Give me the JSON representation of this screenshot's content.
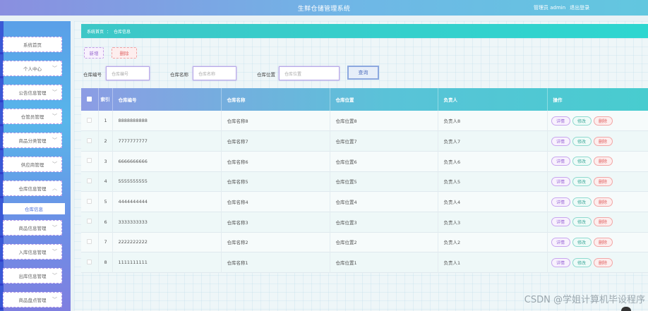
{
  "header": {
    "title": "生鲜仓储管理系统",
    "user": "管理员 admin",
    "logout": "退出登录"
  },
  "sidebar": {
    "items": [
      {
        "label": "系统首页",
        "has_chevron": false
      },
      {
        "label": "个人中心",
        "has_chevron": true
      },
      {
        "label": "公告信息管理",
        "has_chevron": true
      },
      {
        "label": "仓管员管理",
        "has_chevron": true
      },
      {
        "label": "商品分类管理",
        "has_chevron": true
      },
      {
        "label": "供应商管理",
        "has_chevron": true
      },
      {
        "label": "仓库信息管理",
        "has_chevron": true,
        "expanded": true
      },
      {
        "label": "商品信息管理",
        "has_chevron": true
      },
      {
        "label": "入库信息管理",
        "has_chevron": true
      },
      {
        "label": "出库信息管理",
        "has_chevron": true
      },
      {
        "label": "商品盘点管理",
        "has_chevron": true
      }
    ],
    "sub_item": "仓库信息"
  },
  "breadcrumb": {
    "home": "系统首页",
    "sep": "：",
    "current": "仓库信息"
  },
  "toolbar": {
    "add_label": "新增",
    "delete_label": "删除"
  },
  "search": {
    "code_label": "仓库编号",
    "code_placeholder": "仓库编号",
    "name_label": "仓库名称",
    "name_placeholder": "仓库名称",
    "location_label": "仓库位置",
    "location_placeholder": "仓库位置",
    "button": "查询"
  },
  "table": {
    "headers": {
      "index": "索引",
      "code": "仓库编号",
      "name": "仓库名称",
      "location": "仓库位置",
      "manager": "负责人",
      "actions": "操作"
    },
    "rows": [
      {
        "index": "1",
        "code": "8888888888",
        "name": "仓库名称8",
        "location": "仓库位置8",
        "manager": "负责人8"
      },
      {
        "index": "2",
        "code": "7777777777",
        "name": "仓库名称7",
        "location": "仓库位置7",
        "manager": "负责人7"
      },
      {
        "index": "3",
        "code": "6666666666",
        "name": "仓库名称6",
        "location": "仓库位置6",
        "manager": "负责人6"
      },
      {
        "index": "4",
        "code": "5555555555",
        "name": "仓库名称5",
        "location": "仓库位置5",
        "manager": "负责人5"
      },
      {
        "index": "5",
        "code": "4444444444",
        "name": "仓库名称4",
        "location": "仓库位置4",
        "manager": "负责人4"
      },
      {
        "index": "6",
        "code": "3333333333",
        "name": "仓库名称3",
        "location": "仓库位置3",
        "manager": "负责人3"
      },
      {
        "index": "7",
        "code": "2222222222",
        "name": "仓库名称2",
        "location": "仓库位置2",
        "manager": "负责人2"
      },
      {
        "index": "8",
        "code": "1111111111",
        "name": "仓库名称1",
        "location": "仓库位置1",
        "manager": "负责人1"
      }
    ],
    "row_actions": {
      "detail": "详情",
      "edit": "修改",
      "delete": "删除"
    }
  },
  "watermark": "CSDN @学姐计算机毕设程序",
  "colors": {
    "header_start": "#8a8fe0",
    "header_end": "#62c7df",
    "breadcrumb": "#2ed6d0",
    "sidebar": "#58b6ea",
    "table_header_start": "#8c9ce4",
    "table_header_end": "#48cccf"
  }
}
